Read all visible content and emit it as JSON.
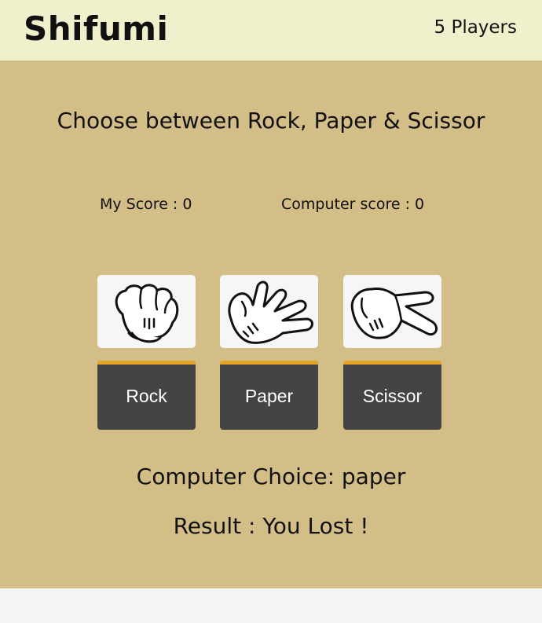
{
  "header": {
    "logo": "Shifumi",
    "players": "5 Players"
  },
  "main": {
    "subtitle": "Choose between Rock, Paper & Scissor",
    "my_score": "My Score : 0",
    "computer_score": "Computer score : 0",
    "choices": [
      {
        "label": "Rock",
        "icon": "rock-hand-icon"
      },
      {
        "label": "Paper",
        "icon": "paper-hand-icon"
      },
      {
        "label": "Scissor",
        "icon": "scissor-hand-icon"
      }
    ],
    "computer_choice": "Computer Choice: paper",
    "result": "Result : You Lost !"
  },
  "colors": {
    "header_bg": "#f0f0cc",
    "main_bg": "#d4be88",
    "button_bg": "#444444",
    "button_accent": "#e4a52a"
  }
}
